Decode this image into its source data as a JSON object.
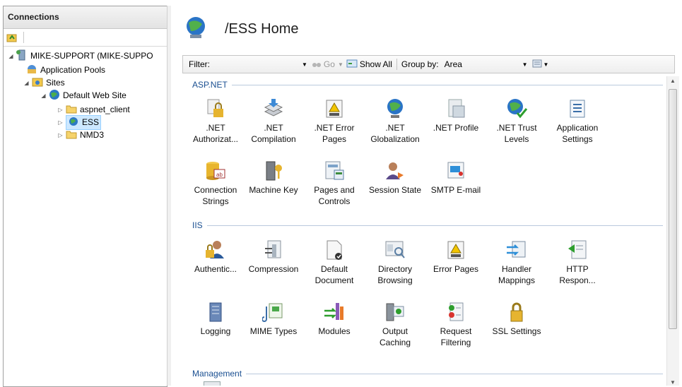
{
  "connections": {
    "header": "Connections",
    "tree": [
      {
        "label": "MIKE-SUPPORT (MIKE-SUPPO",
        "level": 0,
        "expander": "◢"
      },
      {
        "label": "Application Pools",
        "level": 1,
        "expander": ""
      },
      {
        "label": "Sites",
        "level": 1,
        "expander": "◢"
      },
      {
        "label": "Default Web Site",
        "level": 2,
        "expander": "◢"
      },
      {
        "label": "aspnet_client",
        "level": 3,
        "expander": "▷"
      },
      {
        "label": "ESS",
        "level": 3,
        "expander": "▷"
      },
      {
        "label": "NMD3",
        "level": 3,
        "expander": "▷"
      }
    ]
  },
  "page": {
    "title": "/ESS Home"
  },
  "filter": {
    "label": "Filter:",
    "go": "Go",
    "show_all": "Show All",
    "group_by_label": "Group by:",
    "group_by_value": "Area"
  },
  "groups": {
    "aspnet": "ASP.NET",
    "iis": "IIS",
    "management": "Management"
  },
  "features": {
    "aspnet": [
      {
        "l1": ".NET",
        "l2": "Authorizat..."
      },
      {
        "l1": ".NET",
        "l2": "Compilation"
      },
      {
        "l1": ".NET Error",
        "l2": "Pages"
      },
      {
        "l1": ".NET",
        "l2": "Globalization"
      },
      {
        "l1": ".NET Profile",
        "l2": ""
      },
      {
        "l1": ".NET Trust",
        "l2": "Levels"
      },
      {
        "l1": "Application",
        "l2": "Settings"
      },
      {
        "l1": "Connection",
        "l2": "Strings"
      },
      {
        "l1": "Machine Key",
        "l2": ""
      },
      {
        "l1": "Pages and",
        "l2": "Controls"
      },
      {
        "l1": "Session State",
        "l2": ""
      },
      {
        "l1": "SMTP E-mail",
        "l2": ""
      }
    ],
    "iis": [
      {
        "l1": "Authentic...",
        "l2": ""
      },
      {
        "l1": "Compression",
        "l2": ""
      },
      {
        "l1": "Default",
        "l2": "Document"
      },
      {
        "l1": "Directory",
        "l2": "Browsing"
      },
      {
        "l1": "Error Pages",
        "l2": ""
      },
      {
        "l1": "Handler",
        "l2": "Mappings"
      },
      {
        "l1": "HTTP",
        "l2": "Respon..."
      },
      {
        "l1": "Logging",
        "l2": ""
      },
      {
        "l1": "MIME Types",
        "l2": ""
      },
      {
        "l1": "Modules",
        "l2": ""
      },
      {
        "l1": "Output",
        "l2": "Caching"
      },
      {
        "l1": "Request",
        "l2": "Filtering"
      },
      {
        "l1": "SSL Settings",
        "l2": ""
      }
    ]
  }
}
